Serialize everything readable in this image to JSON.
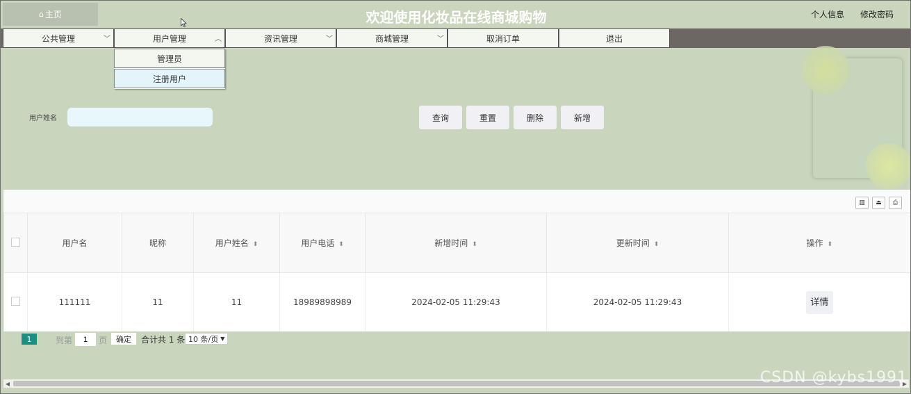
{
  "header": {
    "home_label": "主页",
    "site_title": "欢迎使用化妆品在线商城购物",
    "profile_link": "个人信息",
    "password_link": "修改密码"
  },
  "nav": {
    "items": [
      {
        "label": "公共管理"
      },
      {
        "label": "用户管理"
      },
      {
        "label": "资讯管理"
      },
      {
        "label": "商城管理"
      },
      {
        "label": "取消订单"
      },
      {
        "label": "退出"
      }
    ],
    "dropdown": [
      {
        "label": "管理员"
      },
      {
        "label": "注册用户"
      }
    ]
  },
  "search": {
    "field_label": "用户姓名",
    "input_value": "",
    "buttons": {
      "query": "查询",
      "reset": "重置",
      "delete": "删除",
      "add": "新增"
    }
  },
  "table": {
    "headers": [
      "用户名",
      "昵称",
      "用户姓名",
      "用户电话",
      "新增时间",
      "更新时间",
      "操作"
    ],
    "rows": [
      {
        "username": "111111",
        "nickname": "11",
        "name": "11",
        "phone": "18989898989",
        "created": "2024-02-05 11:29:43",
        "updated": "2024-02-05 11:29:43",
        "action": "详情"
      }
    ]
  },
  "pager": {
    "current": "1",
    "goto_label": "到第",
    "page_input": "1",
    "page_suffix": "页",
    "confirm": "确定",
    "total": "合计共 1 条",
    "page_size": "10 条/页"
  },
  "watermark": "CSDN @kybs1991",
  "colors": {
    "background": "#c9d6bd",
    "nav_bar": "#6d6764",
    "pager_current": "#1e8e82"
  }
}
